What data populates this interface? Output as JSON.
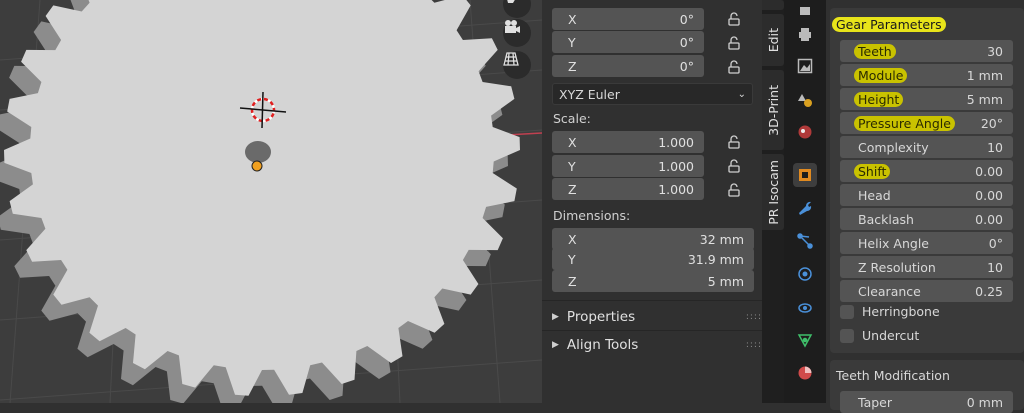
{
  "viewport": {
    "tool_icons": [
      "hand-icon",
      "camera-icon",
      "grid-icon"
    ]
  },
  "npanel": {
    "rotation": {
      "x": {
        "label": "X",
        "value": "0°"
      },
      "y": {
        "label": "Y",
        "value": "0°"
      },
      "z": {
        "label": "Z",
        "value": "0°"
      }
    },
    "rotation_mode": "XYZ Euler",
    "scale_label": "Scale:",
    "scale": {
      "x": {
        "label": "X",
        "value": "1.000"
      },
      "y": {
        "label": "Y",
        "value": "1.000"
      },
      "z": {
        "label": "Z",
        "value": "1.000"
      }
    },
    "dimensions_label": "Dimensions:",
    "dimensions": {
      "x": {
        "label": "X",
        "value": "32 mm"
      },
      "y": {
        "label": "Y",
        "value": "31.9 mm"
      },
      "z": {
        "label": "Z",
        "value": "5 mm"
      }
    },
    "panels": [
      {
        "label": "Properties"
      },
      {
        "label": "Align Tools"
      }
    ]
  },
  "vtabs": [
    "Edit",
    "3D-Print",
    "PR Isocam"
  ],
  "props": {
    "gear_title": "Gear Parameters",
    "params": [
      {
        "label": "Teeth",
        "value": "30"
      },
      {
        "label": "Module",
        "value": "1 mm"
      },
      {
        "label": "Height",
        "value": "5 mm"
      },
      {
        "label": "Pressure Angle",
        "value": "20°"
      },
      {
        "label": "Complexity",
        "value": "10"
      },
      {
        "label": "Shift",
        "value": "0.00"
      },
      {
        "label": "Head",
        "value": "0.00"
      },
      {
        "label": "Backlash",
        "value": "0.00"
      },
      {
        "label": "Helix Angle",
        "value": "0°"
      },
      {
        "label": "Z Resolution",
        "value": "10"
      },
      {
        "label": "Clearance",
        "value": "0.25"
      }
    ],
    "checkboxes": [
      {
        "label": "Herringbone",
        "checked": false
      },
      {
        "label": "Undercut",
        "checked": false
      }
    ],
    "teeth_mod_title": "Teeth Modification",
    "taper": {
      "label": "Taper",
      "value": "0 mm"
    },
    "highlight_color": "#e8e41a"
  }
}
